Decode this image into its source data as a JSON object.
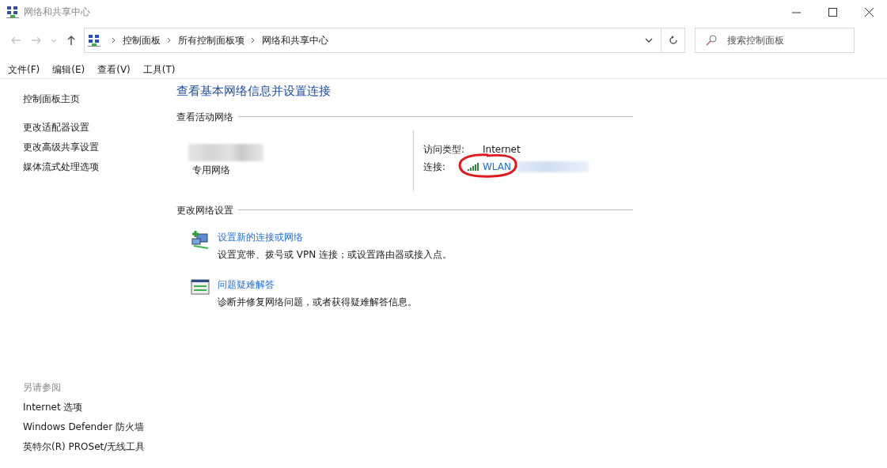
{
  "window": {
    "title": "网络和共享中心"
  },
  "nav_buttons": [
    {
      "kind": "back",
      "disabled": true
    },
    {
      "kind": "forward",
      "disabled": true
    },
    {
      "kind": "recent",
      "disabled": true
    },
    {
      "kind": "up",
      "disabled": false
    }
  ],
  "breadcrumbs": [
    "控制面板",
    "所有控制面板项",
    "网络和共享中心"
  ],
  "search": {
    "placeholder": "搜索控制面板"
  },
  "menu": [
    "文件(F)",
    "编辑(E)",
    "查看(V)",
    "工具(T)"
  ],
  "sidebar": {
    "items": [
      "控制面板主页",
      "更改适配器设置",
      "更改高级共享设置",
      "媒体流式处理选项"
    ],
    "see_also": {
      "heading": "另请参阅",
      "items": [
        "Internet 选项",
        "Windows Defender 防火墙",
        "英特尔(R) PROSet/无线工具"
      ]
    }
  },
  "main": {
    "title": "查看基本网络信息并设置连接",
    "active_networks": {
      "heading": "查看活动网络",
      "network_type": "专用网络",
      "access_type_label": "访问类型:",
      "access_type": "Internet",
      "connection_label": "连接:",
      "connection": "WLAN"
    },
    "change_settings": {
      "heading": "更改网络设置",
      "tasks": [
        {
          "kind": "new-connection",
          "title": "设置新的连接或网络",
          "description": "设置宽带、拨号或 VPN 连接；或设置路由器或接入点。"
        },
        {
          "kind": "troubleshoot",
          "title": "问题疑难解答",
          "description": "诊断并修复网络问题，或者获得疑难解答信息。"
        }
      ]
    }
  }
}
